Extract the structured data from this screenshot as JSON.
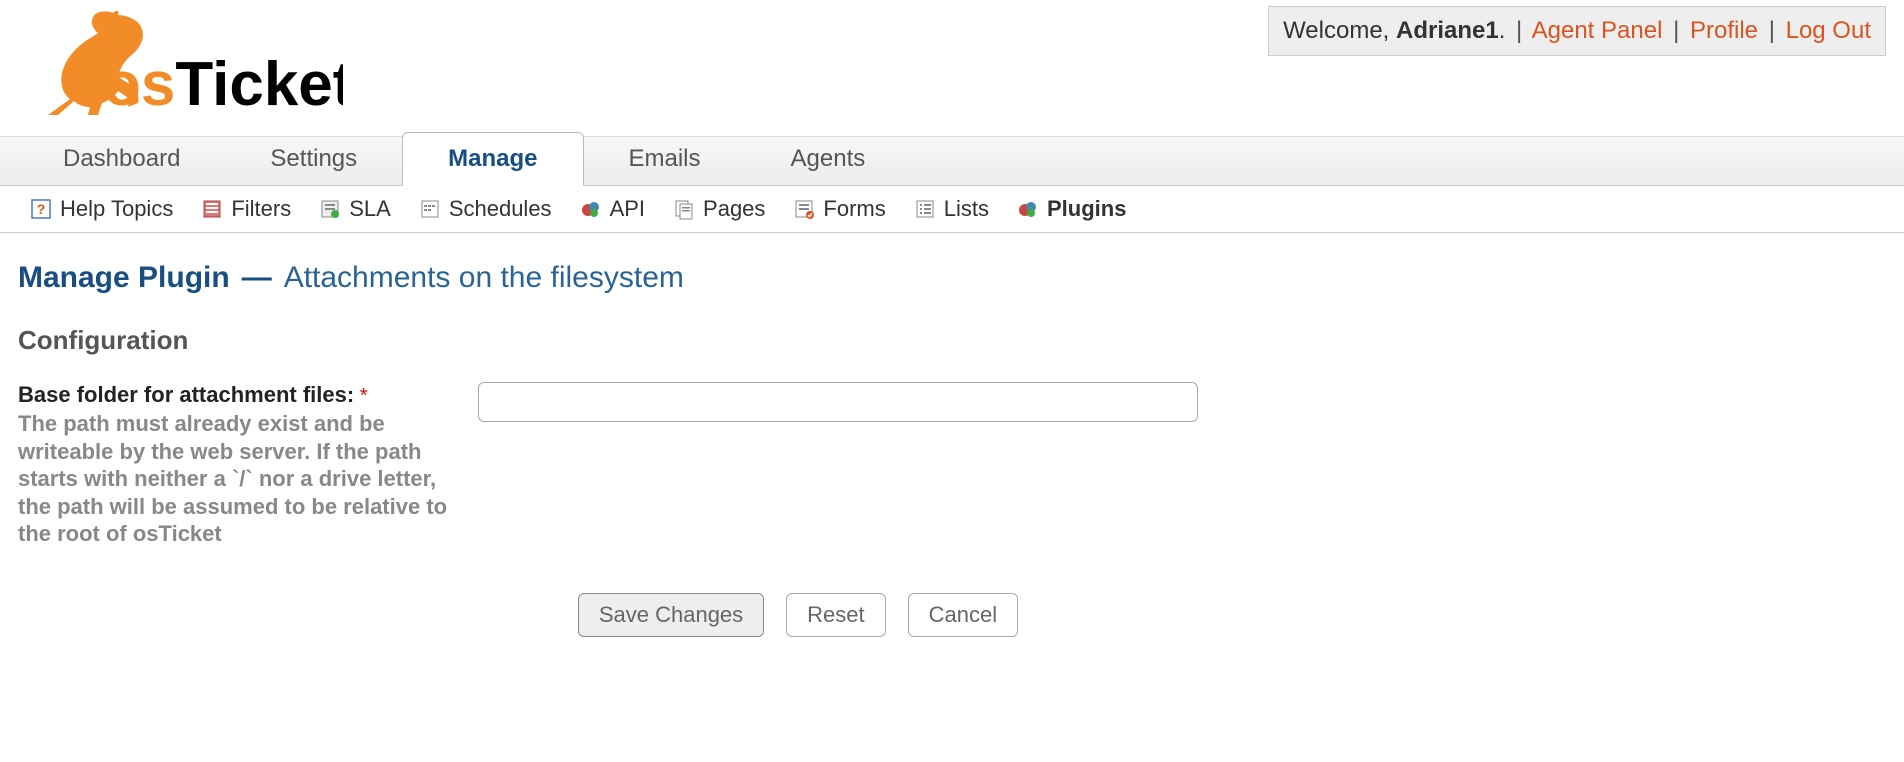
{
  "userbox": {
    "welcome_prefix": "Welcome, ",
    "username": "Adriane1",
    "welcome_suffix": ".",
    "agent_panel": "Agent Panel",
    "profile": "Profile",
    "logout": "Log Out"
  },
  "navbar": {
    "tabs": [
      {
        "label": "Dashboard",
        "active": false
      },
      {
        "label": "Settings",
        "active": false
      },
      {
        "label": "Manage",
        "active": true
      },
      {
        "label": "Emails",
        "active": false
      },
      {
        "label": "Agents",
        "active": false
      }
    ]
  },
  "subnav": {
    "items": [
      {
        "label": "Help Topics",
        "icon": "help-icon",
        "active": false
      },
      {
        "label": "Filters",
        "icon": "filter-icon",
        "active": false
      },
      {
        "label": "SLA",
        "icon": "sla-icon",
        "active": false
      },
      {
        "label": "Schedules",
        "icon": "schedule-icon",
        "active": false
      },
      {
        "label": "API",
        "icon": "api-icon",
        "active": false
      },
      {
        "label": "Pages",
        "icon": "pages-icon",
        "active": false
      },
      {
        "label": "Forms",
        "icon": "forms-icon",
        "active": false
      },
      {
        "label": "Lists",
        "icon": "lists-icon",
        "active": false
      },
      {
        "label": "Plugins",
        "icon": "plugins-icon",
        "active": true
      }
    ]
  },
  "page": {
    "title_main": "Manage Plugin",
    "title_dash": "—",
    "title_sub": "Attachments on the filesystem"
  },
  "config": {
    "section_title": "Configuration",
    "field_label": "Base folder for attachment files:",
    "required_mark": "*",
    "field_hint": "The path must already exist and be writeable by the web server. If the path starts with neither a `/` nor a drive letter, the path will be assumed to be relative to the root of osTicket",
    "field_value": ""
  },
  "buttons": {
    "save": "Save Changes",
    "reset": "Reset",
    "cancel": "Cancel"
  }
}
